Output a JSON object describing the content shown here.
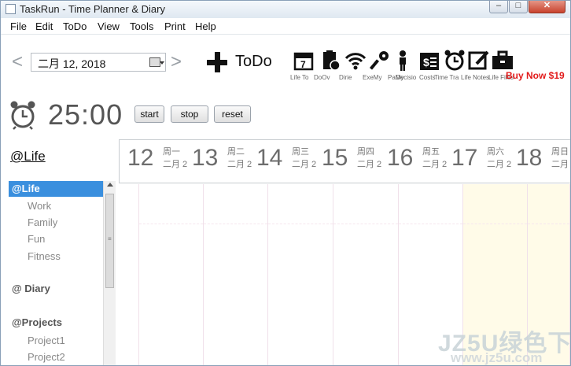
{
  "window": {
    "title": "TaskRun - Time Planner & Diary",
    "min_glyph": "–",
    "max_glyph": "□",
    "close_glyph": "✕"
  },
  "menu": [
    "File",
    "Edit",
    "ToDo",
    "View",
    "Tools",
    "Print",
    "Help"
  ],
  "toolbar": {
    "prev_arrow": "<",
    "next_arrow": ">",
    "date_value": "二月   12, 2018",
    "todo_label": "ToDo",
    "tools": [
      "Life",
      "ToDo",
      "Overview",
      "Diary",
      "Exercise",
      "MyPass",
      "MyPlan",
      "Decision",
      "Costs",
      "Time Track",
      "Life Note",
      "Life Files"
    ],
    "tool_labels_visible": [
      "Life To",
      "DoOv",
      "Dirie",
      "ExeMy",
      "PaMy",
      "Decisio",
      "Costs",
      "Time Tra",
      "Life Notes",
      "Life Files"
    ],
    "buy_now": "Buy Now $19"
  },
  "timer": {
    "value": "25:00",
    "start_label": "start",
    "stop_label": "stop",
    "reset_label": "reset"
  },
  "left_panel": {
    "header": "@Life",
    "tree": [
      {
        "label": "@Life",
        "kind": "cat",
        "selected": true
      },
      {
        "label": "Work",
        "kind": "sub"
      },
      {
        "label": "Family",
        "kind": "sub"
      },
      {
        "label": "Fun",
        "kind": "sub"
      },
      {
        "label": "Fitness",
        "kind": "sub"
      },
      {
        "label": "@ Diary",
        "kind": "cat"
      },
      {
        "label": "@Projects",
        "kind": "cat"
      },
      {
        "label": "Project1",
        "kind": "sub"
      },
      {
        "label": "Project2",
        "kind": "sub"
      }
    ]
  },
  "calendar": {
    "days": [
      {
        "num": "12",
        "week": "周一",
        "month": "二月 2"
      },
      {
        "num": "13",
        "week": "周二",
        "month": "二月 2"
      },
      {
        "num": "14",
        "week": "周三",
        "month": "二月 2"
      },
      {
        "num": "15",
        "week": "周四",
        "month": "二月 2"
      },
      {
        "num": "16",
        "week": "周五",
        "month": "二月 2"
      },
      {
        "num": "17",
        "week": "周六",
        "month": "二月 2"
      },
      {
        "num": "18",
        "week": "周日",
        "month": "二月 2"
      }
    ]
  },
  "watermark": {
    "main": "JZ5U绿色下载",
    "sub": "www.jz5u.com"
  },
  "colors": {
    "selection": "#3a8fde",
    "buy_now": "#e21b1b",
    "weekend": "#fffbe8"
  }
}
